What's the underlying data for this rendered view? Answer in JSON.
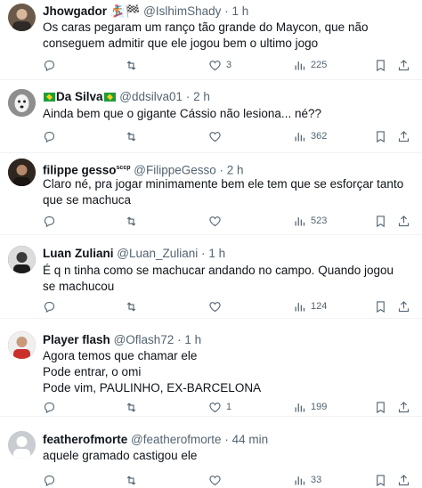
{
  "tweets": [
    {
      "name": "Jhowgador",
      "name_suffix": "🏂🏁",
      "handle": "@IslhimShady",
      "time": "1 h",
      "text": "Os caras pegaram um ranço tão grande do Maycon, que não conseguem admitir que ele jogou bem o ultimo jogo",
      "replies": "",
      "retweets": "",
      "likes": "3",
      "views": "225",
      "avatar_color": "#6b5a4a"
    },
    {
      "name": "Da Silva",
      "name_suffix": "",
      "handle": "@ddsilva01",
      "time": "2 h",
      "text": "Ainda bem que o gigante Cássio não lesiona... né??",
      "replies": "",
      "retweets": "",
      "likes": "",
      "views": "362",
      "avatar_color": "#9a9a9a"
    },
    {
      "name": "filippe gesso",
      "name_suffix": "sccp",
      "handle": "@FilippeGesso",
      "time": "2 h",
      "text": "Claro né, pra jogar minimamente bem ele tem que se esforçar tanto que se machuca",
      "replies": "",
      "retweets": "",
      "likes": "",
      "views": "523",
      "avatar_color": "#3a3028"
    },
    {
      "name": "Luan Zuliani",
      "name_suffix": "",
      "handle": "@Luan_Zuliani",
      "time": "1 h",
      "text": "É q n tinha como se machucar andando no campo. Quando jogou se machucou",
      "replies": "",
      "retweets": "",
      "likes": "",
      "views": "124",
      "avatar_color": "#2b2b2b"
    },
    {
      "name": "Player flash",
      "name_suffix": "",
      "handle": "@Oflash72",
      "time": "1 h",
      "text": "Agora temos que chamar ele\nPode entrar, o omi\nPode vim, PAULINHO, EX-BARCELONA",
      "replies": "",
      "retweets": "",
      "likes": "1",
      "views": "199",
      "avatar_color": "#c9302c"
    },
    {
      "name": "featherofmorte",
      "name_suffix": "",
      "handle": "@featherofmorte",
      "time": "44 min",
      "text": "aquele gramado castigou ele",
      "replies": "",
      "retweets": "",
      "likes": "",
      "views": "33",
      "avatar_color": "#c9cdd2"
    }
  ],
  "separator": "·"
}
